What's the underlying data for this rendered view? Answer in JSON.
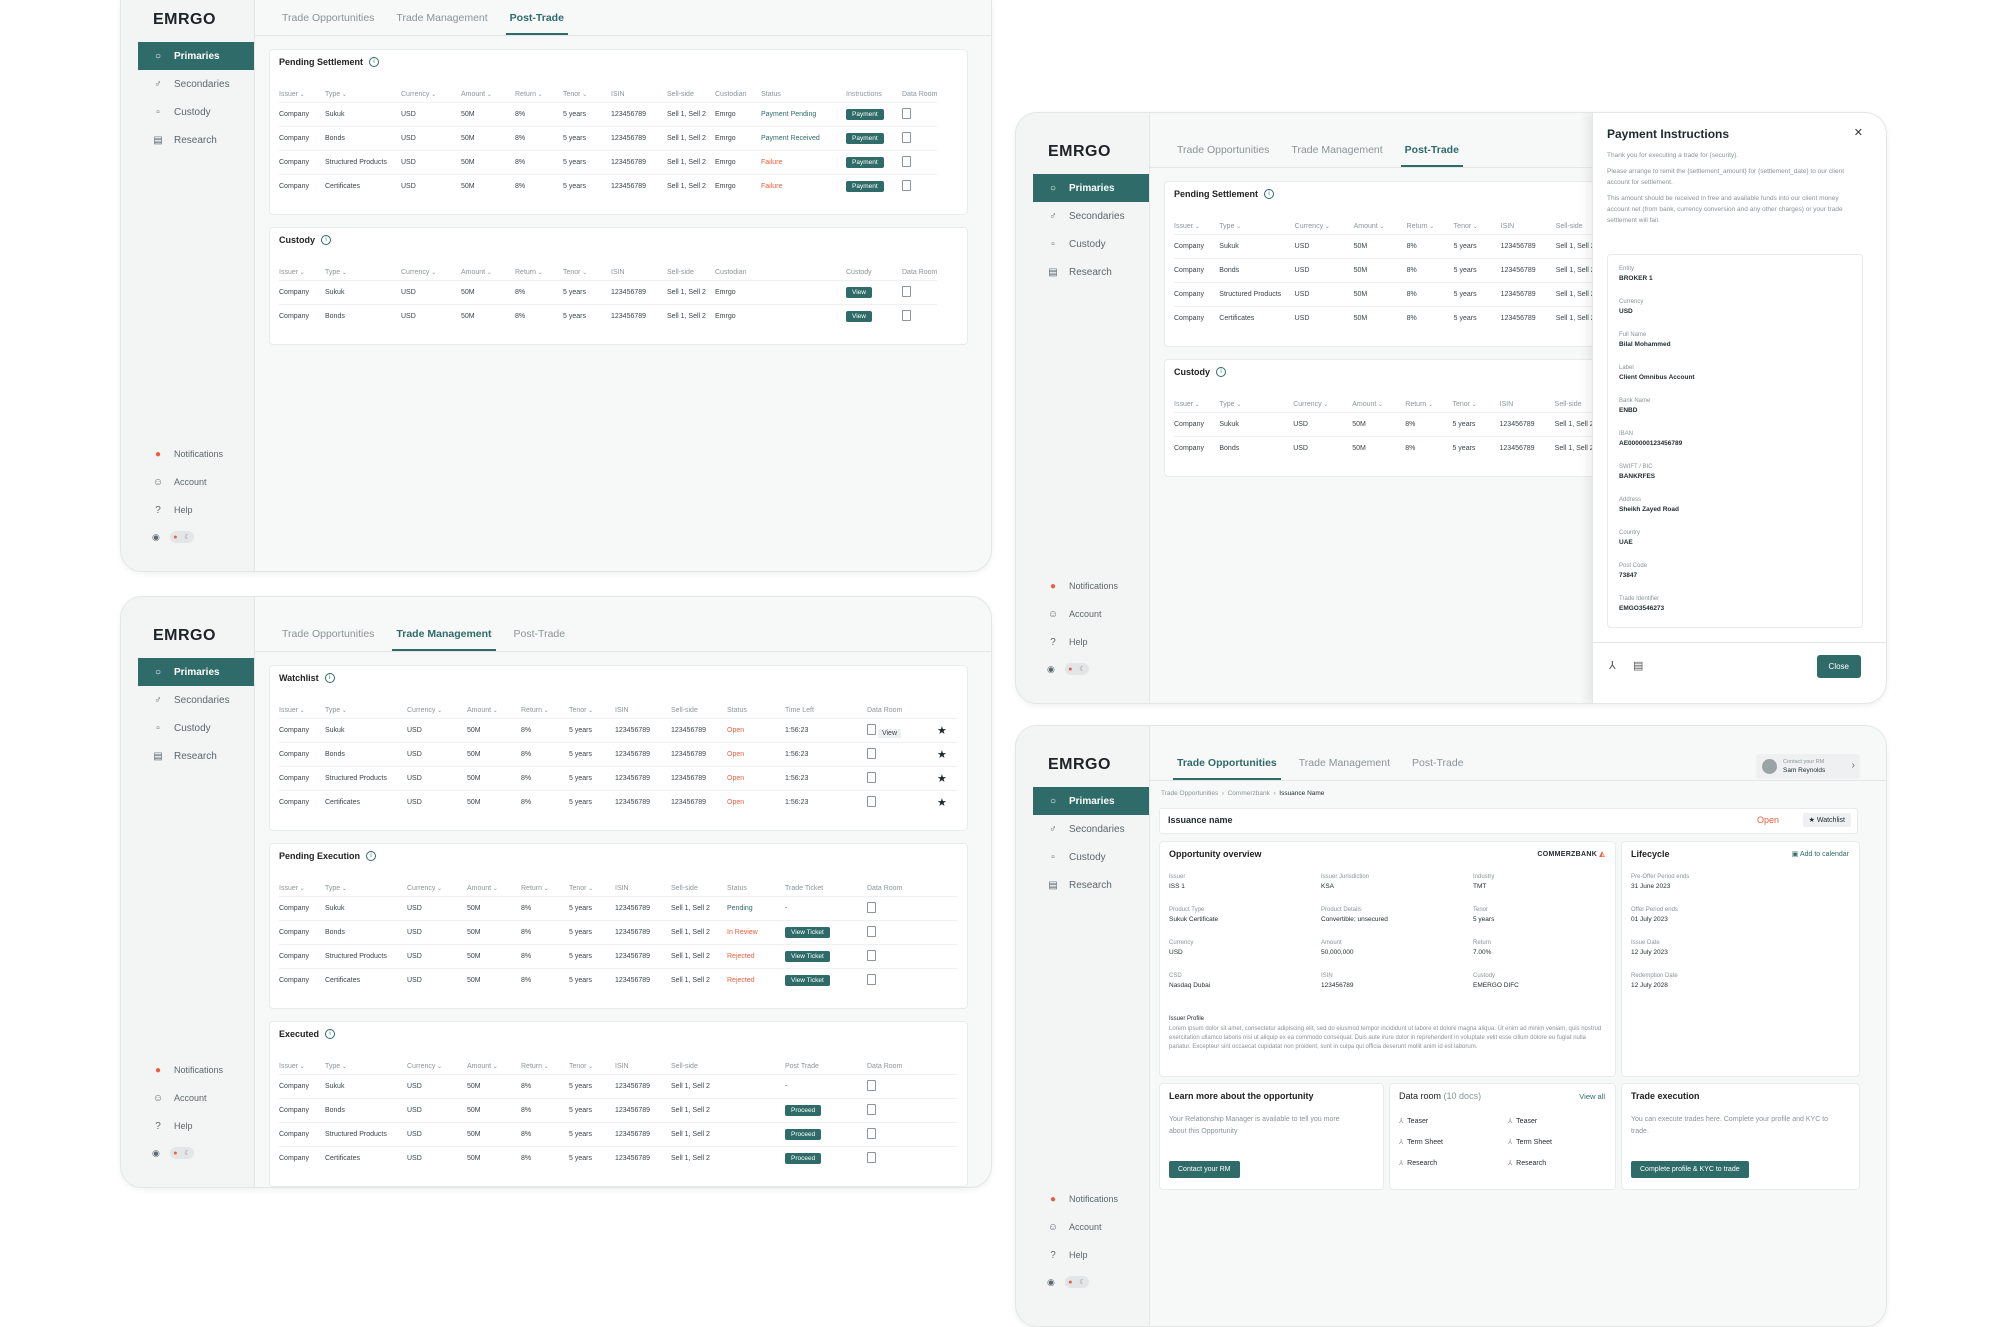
{
  "brand": {
    "logo": "EMRGO",
    "accent": "#2e6b69",
    "alert": "#e8613f"
  },
  "nav": {
    "items": [
      {
        "icon": "circle-icon",
        "label": "Primaries"
      },
      {
        "icon": "pivot-icon",
        "label": "Secondaries"
      },
      {
        "icon": "lock-icon",
        "label": "Custody"
      },
      {
        "icon": "book-icon",
        "label": "Research"
      }
    ],
    "bottom": [
      {
        "icon": "bell-icon",
        "label": "Notifications"
      },
      {
        "icon": "user-icon",
        "label": "Account"
      },
      {
        "icon": "help-icon",
        "label": "Help"
      }
    ]
  },
  "tabs": [
    "Trade Opportunities",
    "Trade Management",
    "Post-Trade"
  ],
  "cols": {
    "issuer": "Issuer",
    "type": "Type",
    "currency": "Currency",
    "amount": "Amount",
    "return": "Return",
    "tenor": "Tenor",
    "isin": "ISIN",
    "sellside": "Sell-side",
    "custodian": "Custodian",
    "status": "Status",
    "instructions": "Instructions",
    "dataroom": "Data Room",
    "custody": "Custody",
    "timeleft": "Time Left",
    "tradeticket": "Trade Ticket",
    "posttrade": "Post Trade"
  },
  "sections": {
    "pending_settlement": "Pending Settlement",
    "custody": "Custody",
    "watchlist": "Watchlist",
    "pending_execution": "Pending Execution",
    "executed": "Executed"
  },
  "row": {
    "issuer": "Company",
    "currency": "USD",
    "amount": "50M",
    "return": "8%",
    "tenor": "5 years",
    "isin": "123456789",
    "sellside": "Sell 1, Sell 2",
    "custodian": "Emrgo"
  },
  "types": [
    "Sukuk",
    "Bonds",
    "Structured Products",
    "Certificates"
  ],
  "post_trade": {
    "settlement_status": [
      "Payment Pending",
      "Payment Received",
      "Failure",
      "Failure"
    ],
    "payment_btn": "Payment",
    "view_btn": "View"
  },
  "trade_mgmt": {
    "watch_status": "Open",
    "time_left": "1:56:23",
    "view_label": "View",
    "exec_status": [
      "Pending",
      "In Review",
      "Rejected",
      "Rejected"
    ],
    "ticket_dash": "-",
    "ticket_btn": "View Ticket",
    "proceed_btn": "Proceed"
  },
  "payment_modal": {
    "title": "Payment Instructions",
    "close_x": "✕",
    "text": [
      "Thank you for executing a trade for {security}.",
      "Please arrange to remit the {settlement_amount} for {settlement_date} to our client account for settlement.",
      "This amount should be received in free and available funds into our client money account net (from bank, currency conversion and any other charges) or your trade settlement will fail."
    ],
    "fields": [
      {
        "label": "Entity",
        "value": "BROKER 1"
      },
      {
        "label": "Currency",
        "value": "USD"
      },
      {
        "label": "Full Name",
        "value": "Bilal Mohammed"
      },
      {
        "label": "Label",
        "value": "Client Omnibus Account"
      },
      {
        "label": "Bank Name",
        "value": "ENBD"
      },
      {
        "label": "IBAN",
        "value": "AE000000123456789"
      },
      {
        "label": "SWIFT / BIC",
        "value": "BANKRFES"
      },
      {
        "label": "Address",
        "value": "Sheikh Zayed Road"
      },
      {
        "label": "Country",
        "value": "UAE"
      },
      {
        "label": "Post Code",
        "value": "73847"
      },
      {
        "label": "Trade Identifier",
        "value": "EMGO3546273"
      }
    ],
    "close_btn": "Close"
  },
  "issuance": {
    "breadcrumb": [
      "Trade Opportunities",
      "Commerzbank",
      "Issuance Name"
    ],
    "rm_label": "Contact your RM",
    "rm_name": "Sam Reynolds",
    "title": "Issuance name",
    "status": "Open",
    "watchlist_btn": "Watchlist",
    "overview_title": "Opportunity overview",
    "bank_logo": "COMMERZBANK",
    "overview": [
      {
        "k": "Issuer",
        "v": "ISS 1"
      },
      {
        "k": "Issuer Jurisdiction",
        "v": "KSA"
      },
      {
        "k": "Industry",
        "v": "TMT"
      },
      {
        "k": "Product Type",
        "v": "Sukuk Certificate"
      },
      {
        "k": "Product Details",
        "v": "Convertible; unsecured"
      },
      {
        "k": "Tenor",
        "v": "5 years"
      },
      {
        "k": "Currency",
        "v": "USD"
      },
      {
        "k": "Amount",
        "v": "50,000,000"
      },
      {
        "k": "Return",
        "v": "7.00%"
      },
      {
        "k": "CSD",
        "v": "Nasdaq Dubai"
      },
      {
        "k": "ISIN",
        "v": "123456789"
      },
      {
        "k": "Custody",
        "v": "EMERGO DIFC"
      }
    ],
    "profile_label": "Issuer Profile",
    "profile_text": "Lorem ipsum dolor sit amet, consectetur adipiscing elit, sed do eiusmod tempor incididunt ut labore et dolore magna aliqua. Ut enim ad minim veniam, quis nostrud exercitation ullamco laboris nisi ut aliquip ex ea commodo consequat. Duis aute irure dolor in reprehenderit in voluptate velit esse cillum dolore eu fugiat nulla pariatur. Excepteur sint occaecat cupidatat non proident, sunt in culpa qui officia deserunt mollit anim id est laborum.",
    "lifecycle_title": "Lifecycle",
    "add_calendar": "Add to calendar",
    "lifecycle": [
      {
        "k": "Pre-Offer Period ends",
        "v": "31 June 2023"
      },
      {
        "k": "Offer Period ends",
        "v": "01 July 2023"
      },
      {
        "k": "Issue Date",
        "v": "12 July 2023"
      },
      {
        "k": "Redemption Date",
        "v": "12 July 2028"
      }
    ],
    "learn_title": "Learn more about the opportunity",
    "learn_text": "Your Relationship Manager is available to tell you more about this Opportunity",
    "contact_btn": "Contact your RM",
    "dataroom_title": "Data room",
    "dataroom_count": "(10 docs)",
    "view_all": "View all",
    "docs": [
      "Teaser",
      "Teaser",
      "Term Sheet",
      "Term Sheet",
      "Research",
      "Research"
    ],
    "exec_title": "Trade execution",
    "exec_text": "You can execute trades here. Complete your profile and KYC to trade.",
    "kyc_btn": "Complete profile & KYC to trade"
  }
}
